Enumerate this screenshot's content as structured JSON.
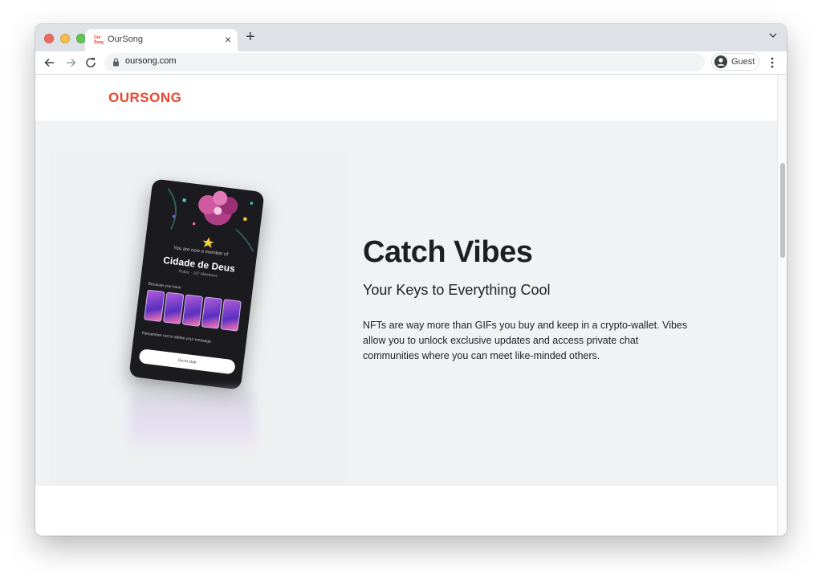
{
  "browser": {
    "tab": {
      "title": "OurSong",
      "favicon_text": "Our Song"
    },
    "omnibox": {
      "url": "oursong.com"
    },
    "profile": {
      "label": "Guest"
    }
  },
  "site": {
    "logo": "OURSONG",
    "hero": {
      "headline": "Catch Vibes",
      "subhead": "Your Keys to Everything Cool",
      "body": "NFTs are way more than GIFs you buy and keep in a crypto-wallet. Vibes allow you to unlock exclusive updates and access private chat communities where you can meet like-minded others."
    },
    "phone": {
      "member_text": "You are now a member of",
      "club_name": "Cidade de Deus",
      "meta": "Public · 187 Members",
      "because": "Because you have",
      "reminder": "Remember not to delete your message",
      "cta": "Go to club"
    }
  },
  "colors": {
    "brand": "#e8482f",
    "hero_bg": "#f1f2f4",
    "text": "#1f1f1f"
  }
}
